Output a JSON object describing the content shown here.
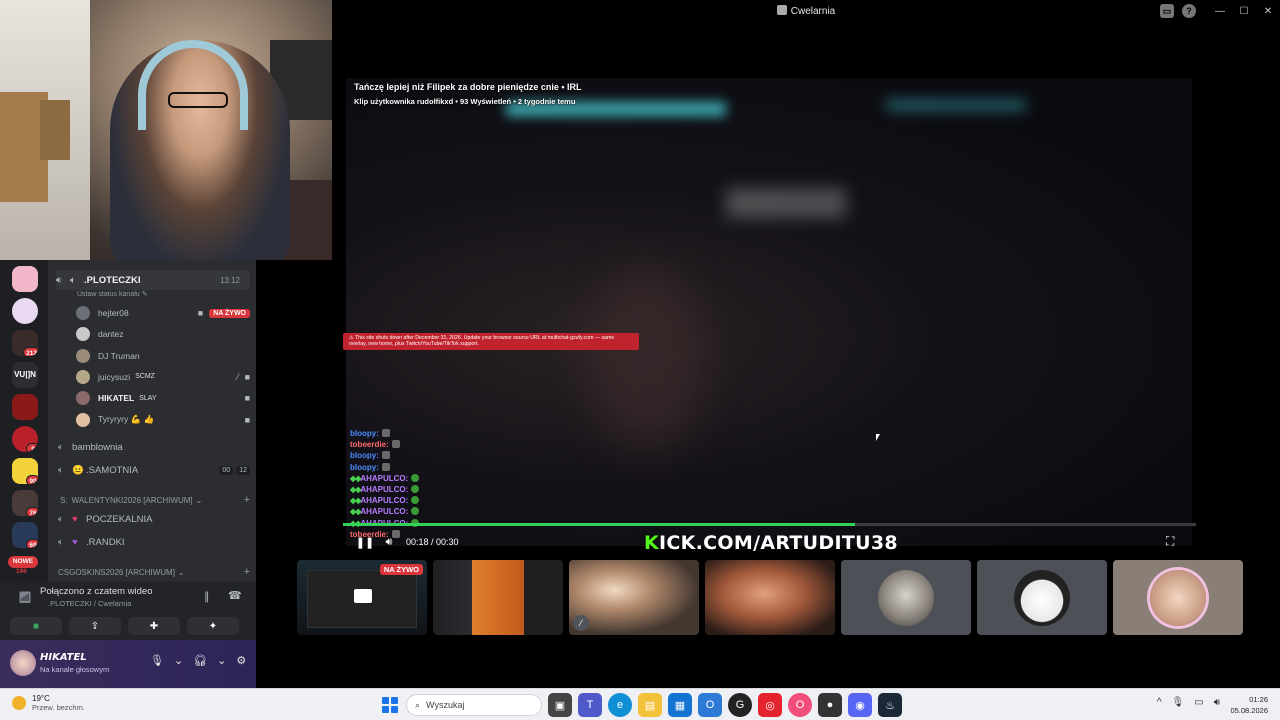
{
  "window": {
    "title": "Cwelarnia",
    "controls": [
      "—",
      "☐",
      "✕"
    ]
  },
  "stream": {
    "clip_title": "Tańczę lepiej niż Filipek za dobre pieniędze cnie • IRL",
    "clip_meta": "Klip użytkownika rudolfikxd • 93 Wyświetleń • 2 tygodnie temu",
    "warning_text": "⚠ This site shuts down after December 31, 2026. Update your browser source URL at multichat-gzufy.com — same overlay, new home, plus Twitch/YouTube/TikTok support.",
    "time_current": "00:18",
    "time_total": "00:30",
    "time_display": "00:18 / 00:30",
    "progress": 0.6,
    "banner_k": "K",
    "banner_rest": "ICK.COM/ARTUDITU38",
    "chat": [
      {
        "name": "bloopy:",
        "color": "blue",
        "dots": ""
      },
      {
        "name": "tobeerdie:",
        "color": "red",
        "dots": ""
      },
      {
        "name": "bloopy:",
        "color": "blue",
        "dots": ""
      },
      {
        "name": "bloopy:",
        "color": "blue",
        "dots": ""
      },
      {
        "name": "AHAPULCO:",
        "color": "purple",
        "dots": "◆◆"
      },
      {
        "name": "AHAPULCO:",
        "color": "purple",
        "dots": "◆◆"
      },
      {
        "name": "AHAPULCO:",
        "color": "purple",
        "dots": "◆◆"
      },
      {
        "name": "AHAPULCO:",
        "color": "purple",
        "dots": "◆◆"
      },
      {
        "name": "AHAPULCO:",
        "color": "purple",
        "dots": "◆◆"
      },
      {
        "name": "tobeerdie:",
        "color": "red",
        "dots": ""
      }
    ]
  },
  "participants": {
    "live_label": "NA ŻYWO"
  },
  "servers": {
    "badges": [
      "212",
      "9",
      "90",
      "76",
      "69",
      "196"
    ],
    "vuln_label": "VU|]N",
    "new_label": "NOWE"
  },
  "channels": {
    "active_channel": ".PLOTECZKI",
    "active_time": "13:12",
    "status_hint": "Ustaw status kanału ✎",
    "users": [
      {
        "name": "hejter08",
        "tag": "",
        "live": "NA ŻYWO"
      },
      {
        "name": "dantez",
        "tag": "",
        "live": ""
      },
      {
        "name": "DJ Truman",
        "tag": "",
        "live": ""
      },
      {
        "name": "juicysuzi",
        "tag": "SCMZ",
        "live": ""
      },
      {
        "name": "HIKATEL",
        "tag": "SLAY",
        "live": ""
      },
      {
        "name": "Tyryryry 💪 👍",
        "tag": "",
        "live": ""
      }
    ],
    "other": [
      {
        "name": "bamblownia"
      },
      {
        "name": ".SAMOTNIA",
        "chip1": "00",
        "chip2": "12"
      }
    ],
    "category1": "WALENTYNKI2026 [ARCHIWUM]",
    "category1_prefix": "S:",
    "sub1": "POCZEKALNIA",
    "sub2": ".RANDKI",
    "category2": "CSGOSKINS2026 [ARCHIWUM]"
  },
  "voice": {
    "title": "Połączono z czatem wideo",
    "subtitle": ".PLOTECZKI / Cwelarnia"
  },
  "user": {
    "name": "HIKATEL",
    "status": "Na kanale głosowym"
  },
  "taskbar": {
    "temp": "19°C",
    "condition": "Przew. bezchm.",
    "search_placeholder": "Wyszukaj",
    "time": "01:26",
    "date": "05.08.2026"
  }
}
